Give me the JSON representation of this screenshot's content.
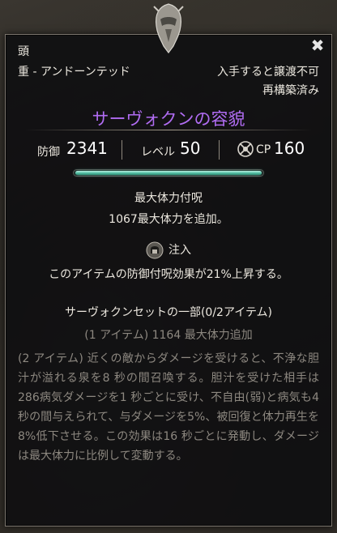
{
  "item": {
    "slot": "頭",
    "weight_set": "重 - アンドーンテッド",
    "bind": "入手すると譲渡不可",
    "retraited": "再構築済み",
    "name": "サーヴォクンの容貌",
    "name_color": "#b06cf2"
  },
  "stats": {
    "armor_label": "防御",
    "armor_value": "2341",
    "level_label": "レベル",
    "level_value": "50",
    "cp_label": "CP",
    "cp_value": "160"
  },
  "condition": {
    "fill": 1.0,
    "color": "#56c2a6"
  },
  "enchantment": {
    "title": "最大体力付呪",
    "description": "1067最大体力を追加。"
  },
  "trait": {
    "icon": "infused-trait-icon",
    "title": "注入",
    "description": "このアイテムの防御付呪効果が21%上昇する。"
  },
  "set": {
    "title": "サーヴォクンセットの一部(0/2アイテム)",
    "bonus_1": "(1 アイテム) 1164 最大体力追加",
    "bonus_2": "(2 アイテム) 近くの敵からダメージを受けると、不浄な胆汁が溢れる泉を8 秒の間召喚する。胆汁を受けた相手は286病気ダメージを1 秒ごとに受け、不自由(弱)と病気も4 秒の間与えられて、与ダメージを5%、被回復と体力再生を8%低下させる。この効果は16 秒ごとに発動し、ダメージは最大体力に比例して変動する。"
  },
  "close_icon": "close-icon",
  "close_glyph": "✖"
}
